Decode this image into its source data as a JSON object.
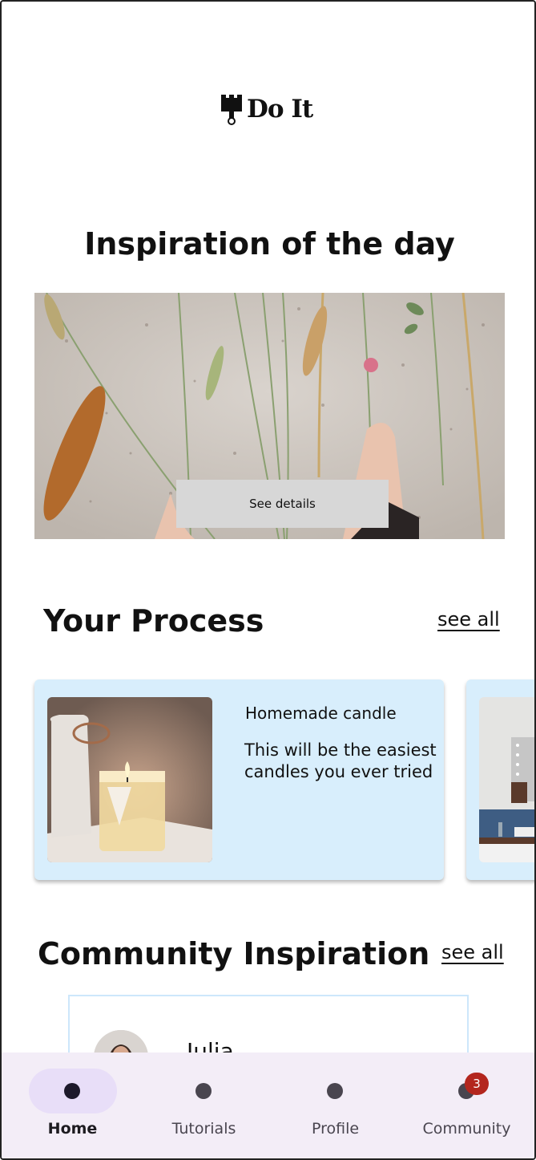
{
  "app": {
    "logo_text": "Do It"
  },
  "hero": {
    "title": "Inspiration of the day",
    "button_label": "See details"
  },
  "process": {
    "title": "Your Process",
    "see_all": "see all",
    "cards": [
      {
        "title": "Homemade candle",
        "description": "This will be the easiest candles you ever tried"
      }
    ]
  },
  "community": {
    "title": "Community Inspiration",
    "see_all": "see all",
    "posts": [
      {
        "author": "Julia"
      }
    ]
  },
  "nav": {
    "items": [
      {
        "label": "Home",
        "icon": "home-icon",
        "active": true
      },
      {
        "label": "Tutorials",
        "icon": "tutorials-icon",
        "active": false
      },
      {
        "label": "Profile",
        "icon": "profile-icon",
        "active": false
      },
      {
        "label": "Community",
        "icon": "community-icon",
        "active": false,
        "badge": "3"
      }
    ]
  },
  "colors": {
    "card_bg": "#d8eefc",
    "nav_bg": "#f3edf7",
    "nav_active_pill": "#e8def8",
    "badge": "#b3261e"
  }
}
